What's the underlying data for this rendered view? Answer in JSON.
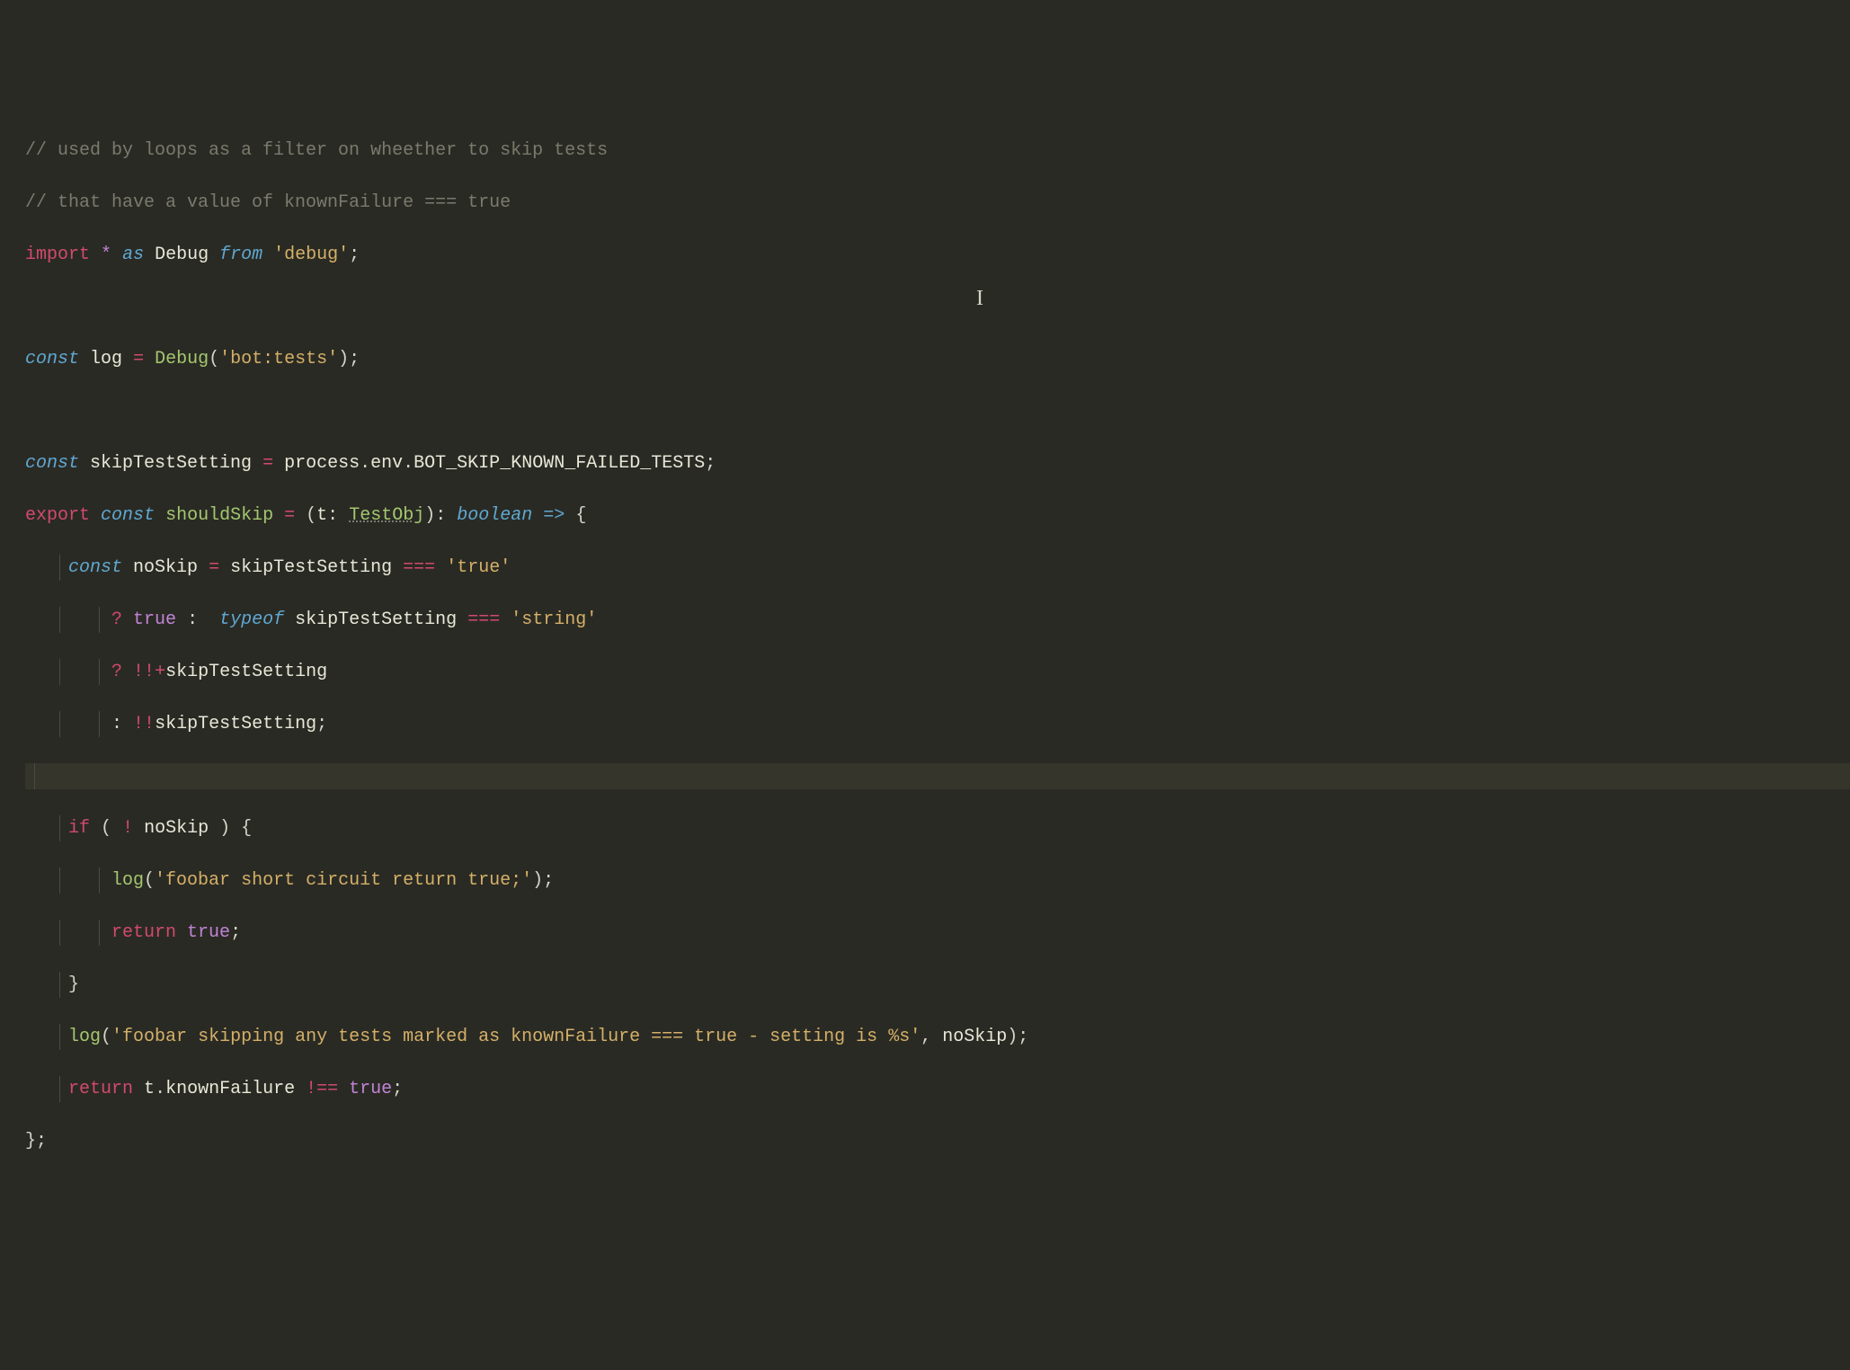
{
  "code": {
    "l1_comment": "// used by loops as a filter on wheether to skip tests",
    "l2_comment": "// that have a value of knownFailure === true",
    "l3": {
      "import": "import",
      "star": "*",
      "as": "as",
      "debug": "Debug",
      "from": "from",
      "module": "'debug'",
      "semi": ";"
    },
    "l5": {
      "const": "const",
      "log": "log",
      "eq": "=",
      "fn": "Debug",
      "arg": "'bot:tests'",
      "close": ");"
    },
    "l7": {
      "const": "const",
      "var": "skipTestSetting",
      "eq": "=",
      "process": "process",
      "env": "env",
      "prop": "BOT_SKIP_KNOWN_FAILED_TESTS",
      "semi": ";"
    },
    "l8": {
      "export": "export",
      "const": "const",
      "fn": "shouldSkip",
      "eq": "=",
      "paren_open": "(",
      "param": "t",
      "colon": ":",
      "type": "TestObj",
      "paren_close": ")",
      "ret_colon": ":",
      "ret_type": "boolean",
      "arrow": "=>",
      "brace": "{"
    },
    "l9": {
      "const": "const",
      "var": "noSkip",
      "eq": "=",
      "expr": "skipTestSetting",
      "op": "===",
      "str": "'true'"
    },
    "l10": {
      "q": "?",
      "true": "true",
      "colon": ":",
      "typeof": "typeof",
      "var": "skipTestSetting",
      "op": "===",
      "str": "'string'"
    },
    "l11": {
      "q": "?",
      "bangs": "!!",
      "plus": "+",
      "var": "skipTestSetting"
    },
    "l12": {
      "colon": ":",
      "bangs": "!!",
      "var": "skipTestSetting",
      "semi": ";"
    },
    "l14": {
      "if": "if",
      "open": "(",
      "bang": "!",
      "var": "noSkip",
      "close": ")",
      "brace": "{"
    },
    "l15": {
      "fn": "log",
      "arg": "'foobar short circuit return true;'",
      "close": ");"
    },
    "l16": {
      "return": "return",
      "true": "true",
      "semi": ";"
    },
    "l17": {
      "brace": "}"
    },
    "l18": {
      "fn": "log",
      "arg": "'foobar skipping any tests marked as knownFailure === true - setting is %s'",
      "comma": ",",
      "var": "noSkip",
      "close": ");"
    },
    "l19": {
      "return": "return",
      "obj": "t",
      "dot": ".",
      "prop": "knownFailure",
      "op": "!==",
      "true": "true",
      "semi": ";"
    },
    "l20": {
      "close": "};"
    }
  }
}
